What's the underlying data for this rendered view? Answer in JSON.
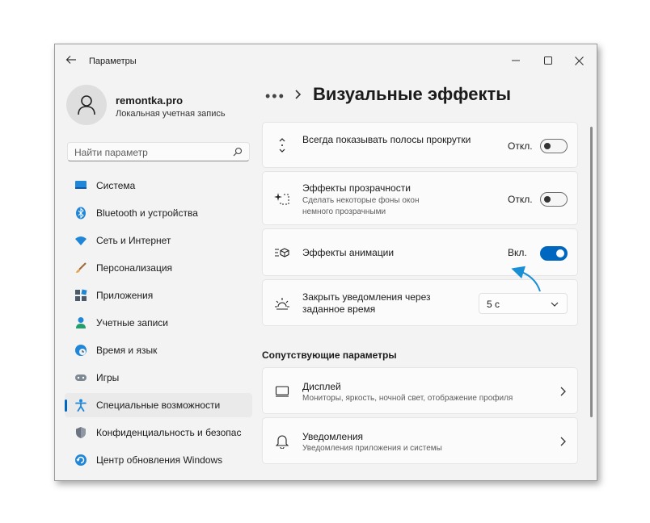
{
  "window": {
    "title": "Параметры",
    "controls": [
      "minimize-icon",
      "maximize-icon",
      "close-icon"
    ]
  },
  "profile": {
    "name": "remontka.pro",
    "account_type": "Локальная учетная запись"
  },
  "search": {
    "placeholder": "Найти параметр"
  },
  "sidebar": {
    "items": [
      {
        "label": "Система",
        "icon": "display-icon",
        "active": false
      },
      {
        "label": "Bluetooth и устройства",
        "icon": "bluetooth-icon",
        "active": false
      },
      {
        "label": "Сеть и Интернет",
        "icon": "wifi-icon",
        "active": false
      },
      {
        "label": "Персонализация",
        "icon": "brush-icon",
        "active": false
      },
      {
        "label": "Приложения",
        "icon": "apps-icon",
        "active": false
      },
      {
        "label": "Учетные записи",
        "icon": "person-icon",
        "active": false
      },
      {
        "label": "Время и язык",
        "icon": "globe-clock-icon",
        "active": false
      },
      {
        "label": "Игры",
        "icon": "gamepad-icon",
        "active": false
      },
      {
        "label": "Специальные возможности",
        "icon": "accessibility-icon",
        "active": true
      },
      {
        "label": "Конфиденциальность и безопас",
        "icon": "shield-icon",
        "active": false
      },
      {
        "label": "Центр обновления Windows",
        "icon": "update-icon",
        "active": false
      }
    ]
  },
  "breadcrumb": {
    "dots": "•••",
    "title": "Визуальные эффекты"
  },
  "settings": [
    {
      "title": "Всегда показывать полосы прокрутки",
      "state": "Откл.",
      "on": false
    },
    {
      "title": "Эффекты прозрачности",
      "desc": "Сделать некоторые фоны окон немного прозрачными",
      "state": "Откл.",
      "on": false
    },
    {
      "title": "Эффекты анимации",
      "state": "Вкл.",
      "on": true
    },
    {
      "title": "Закрыть уведомления через заданное время",
      "value": "5 с"
    }
  ],
  "related": {
    "title": "Сопутствующие параметры",
    "items": [
      {
        "title": "Дисплей",
        "desc": "Мониторы, яркость, ночной свет, отображение профиля"
      },
      {
        "title": "Уведомления",
        "desc": "Уведомления приложения и системы"
      }
    ]
  },
  "colors": {
    "accent": "#0067c0",
    "annotation_arrow": "#1a8fd6"
  }
}
